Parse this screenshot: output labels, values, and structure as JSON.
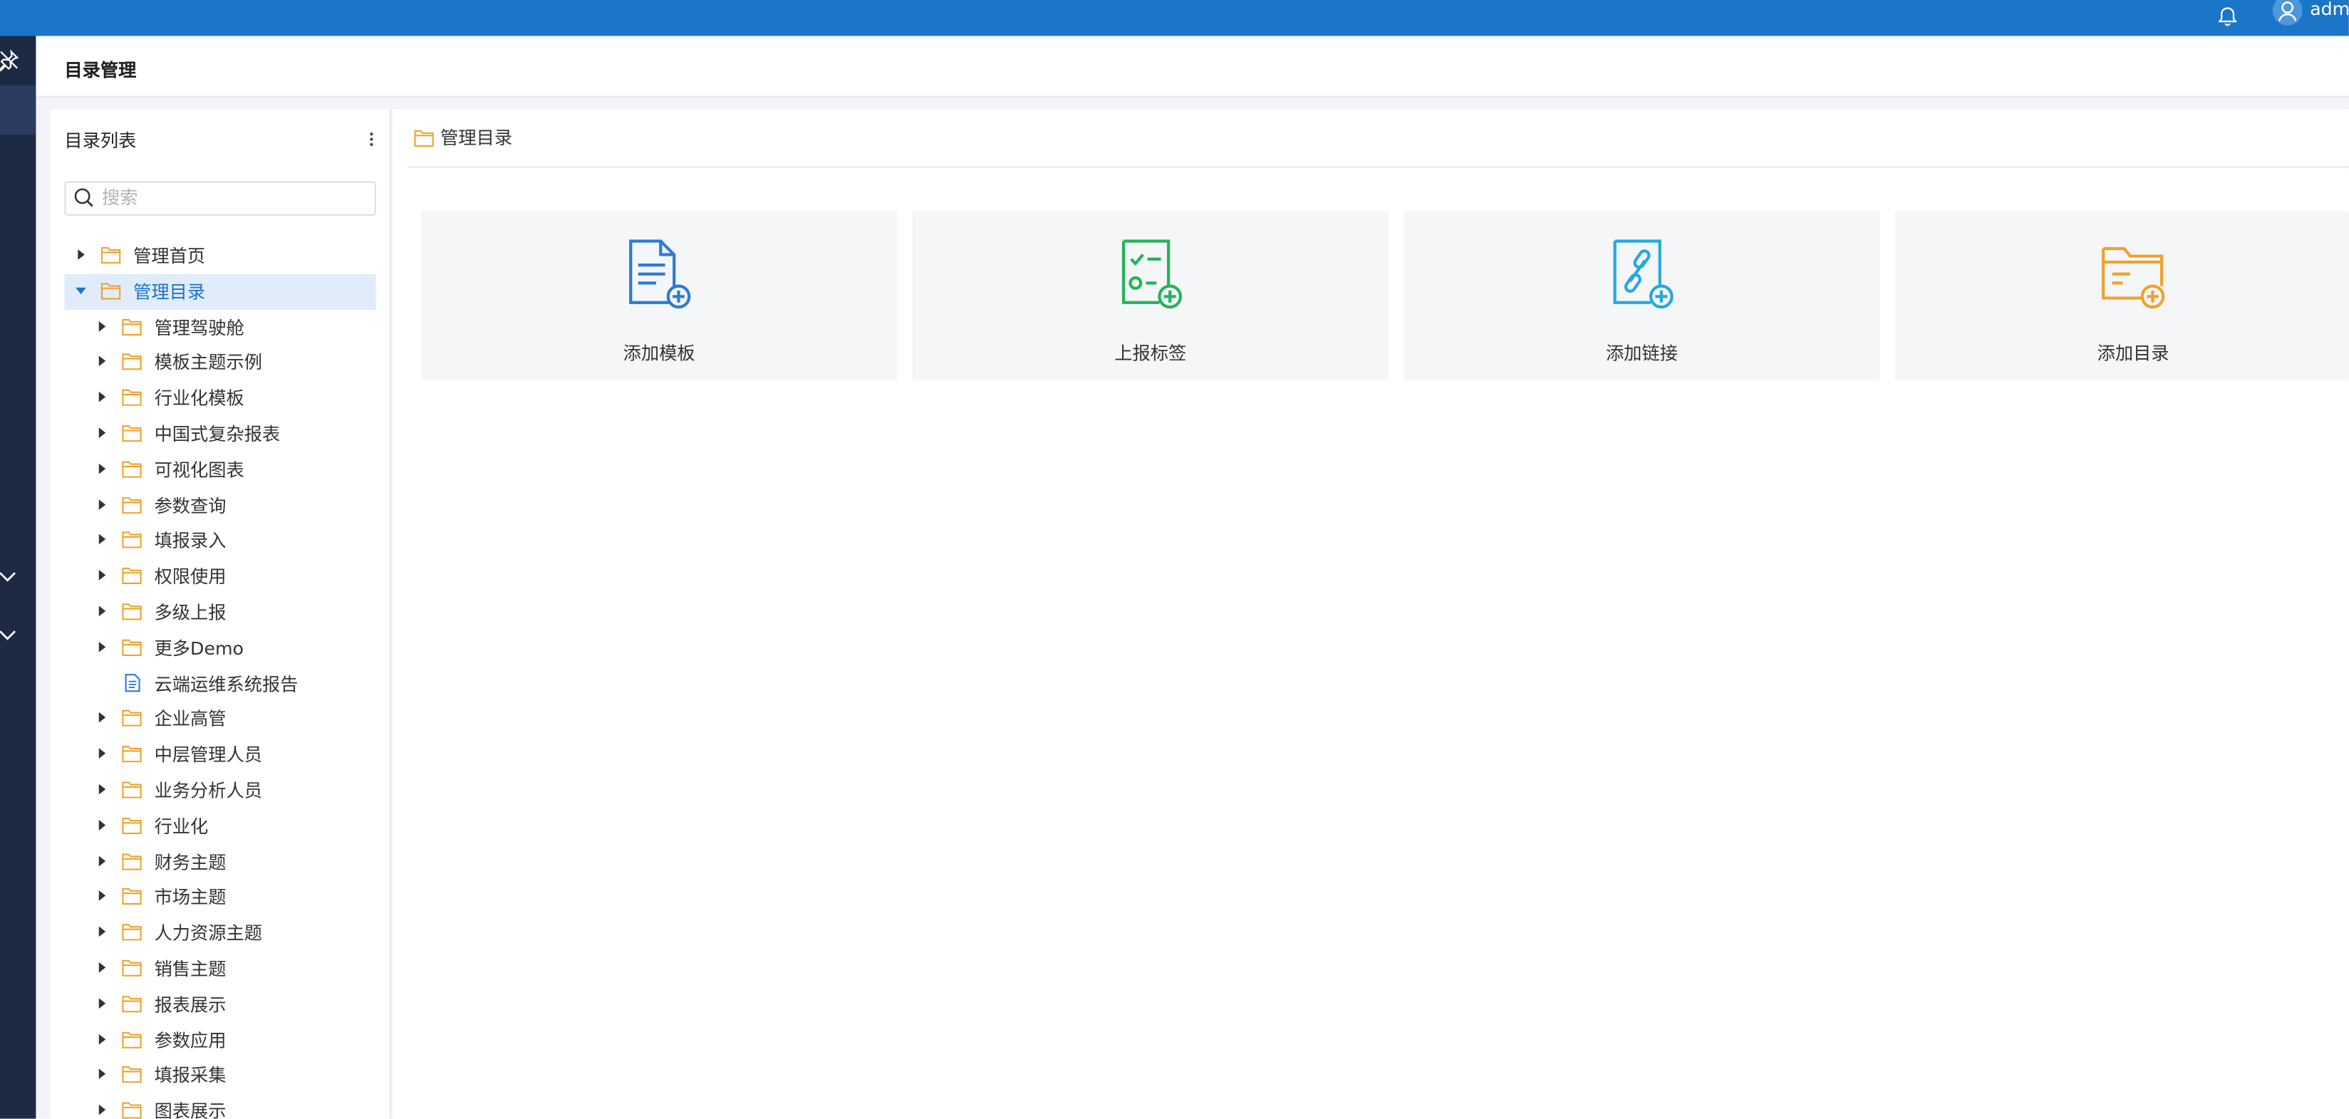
{
  "topbar": {
    "username": "admi"
  },
  "page": {
    "title": "目录管理"
  },
  "tree_panel": {
    "title": "目录列表",
    "search_placeholder": "搜索",
    "items": [
      {
        "label": "管理首页",
        "level": 0,
        "type": "folder",
        "expanded": false,
        "selected": false
      },
      {
        "label": "管理目录",
        "level": 0,
        "type": "folder",
        "expanded": true,
        "selected": true
      },
      {
        "label": "管理驾驶舱",
        "level": 1,
        "type": "folder",
        "expanded": false,
        "selected": false
      },
      {
        "label": "模板主题示例",
        "level": 1,
        "type": "folder",
        "expanded": false,
        "selected": false
      },
      {
        "label": "行业化模板",
        "level": 1,
        "type": "folder",
        "expanded": false,
        "selected": false
      },
      {
        "label": "中国式复杂报表",
        "level": 1,
        "type": "folder",
        "expanded": false,
        "selected": false
      },
      {
        "label": "可视化图表",
        "level": 1,
        "type": "folder",
        "expanded": false,
        "selected": false
      },
      {
        "label": "参数查询",
        "level": 1,
        "type": "folder",
        "expanded": false,
        "selected": false
      },
      {
        "label": "填报录入",
        "level": 1,
        "type": "folder",
        "expanded": false,
        "selected": false
      },
      {
        "label": "权限使用",
        "level": 1,
        "type": "folder",
        "expanded": false,
        "selected": false
      },
      {
        "label": "多级上报",
        "level": 1,
        "type": "folder",
        "expanded": false,
        "selected": false
      },
      {
        "label": "更多Demo",
        "level": 1,
        "type": "folder",
        "expanded": false,
        "selected": false
      },
      {
        "label": "云端运维系统报告",
        "level": 1,
        "type": "file",
        "expanded": false,
        "selected": false
      },
      {
        "label": "企业高管",
        "level": 1,
        "type": "folder",
        "expanded": false,
        "selected": false
      },
      {
        "label": "中层管理人员",
        "level": 1,
        "type": "folder",
        "expanded": false,
        "selected": false
      },
      {
        "label": "业务分析人员",
        "level": 1,
        "type": "folder",
        "expanded": false,
        "selected": false
      },
      {
        "label": "行业化",
        "level": 1,
        "type": "folder",
        "expanded": false,
        "selected": false
      },
      {
        "label": "财务主题",
        "level": 1,
        "type": "folder",
        "expanded": false,
        "selected": false
      },
      {
        "label": "市场主题",
        "level": 1,
        "type": "folder",
        "expanded": false,
        "selected": false
      },
      {
        "label": "人力资源主题",
        "level": 1,
        "type": "folder",
        "expanded": false,
        "selected": false
      },
      {
        "label": "销售主题",
        "level": 1,
        "type": "folder",
        "expanded": false,
        "selected": false
      },
      {
        "label": "报表展示",
        "level": 1,
        "type": "folder",
        "expanded": false,
        "selected": false
      },
      {
        "label": "参数应用",
        "level": 1,
        "type": "folder",
        "expanded": false,
        "selected": false
      },
      {
        "label": "填报采集",
        "level": 1,
        "type": "folder",
        "expanded": false,
        "selected": false
      },
      {
        "label": "图表展示",
        "level": 1,
        "type": "folder",
        "expanded": false,
        "selected": false
      }
    ]
  },
  "main": {
    "title": "管理目录",
    "cards": [
      {
        "label": "添加模板",
        "icon": "add-template-icon",
        "color": "#2b7bd7"
      },
      {
        "label": "上报标签",
        "icon": "report-tag-icon",
        "color": "#24b35a"
      },
      {
        "label": "添加链接",
        "icon": "add-link-icon",
        "color": "#25a8e0"
      },
      {
        "label": "添加目录",
        "icon": "add-folder-icon",
        "color": "#f0a22b"
      }
    ]
  },
  "colors": {
    "topbar": "#1b75c9",
    "sidebar": "#1e2a44",
    "folder": "#f0a22b",
    "file": "#2b7bd7",
    "selection": "#e1ecfb"
  }
}
